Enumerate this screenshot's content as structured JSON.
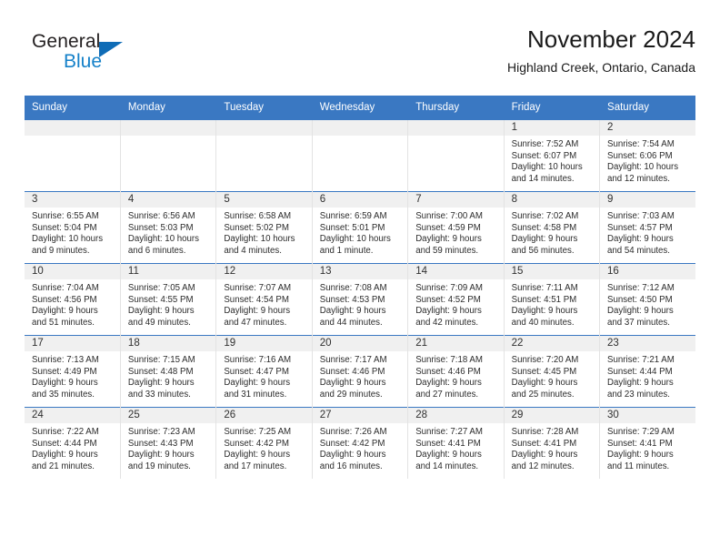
{
  "logo": {
    "word_top": "General",
    "word_bottom": "Blue",
    "triangle_color": "#0f6cb6",
    "blue_color": "#1581c9",
    "icon": "general-blue-logo"
  },
  "header": {
    "title": "November 2024",
    "subtitle": "Highland Creek, Ontario, Canada"
  },
  "theme": {
    "accent": "#3a78c2",
    "date_strip": "#f0f0f0",
    "grid_line": "#e3e3e3"
  },
  "weekdays": [
    "Sunday",
    "Monday",
    "Tuesday",
    "Wednesday",
    "Thursday",
    "Friday",
    "Saturday"
  ],
  "labels": {
    "sunrise": "Sunrise:",
    "sunset": "Sunset:",
    "daylight": "Daylight:"
  },
  "weeks": [
    [
      {
        "date": "",
        "empty": true
      },
      {
        "date": "",
        "empty": true
      },
      {
        "date": "",
        "empty": true
      },
      {
        "date": "",
        "empty": true
      },
      {
        "date": "",
        "empty": true
      },
      {
        "date": "1",
        "sunrise": "Sunrise: 7:52 AM",
        "sunset": "Sunset: 6:07 PM",
        "daylight_1": "Daylight: 10 hours",
        "daylight_2": "and 14 minutes."
      },
      {
        "date": "2",
        "sunrise": "Sunrise: 7:54 AM",
        "sunset": "Sunset: 6:06 PM",
        "daylight_1": "Daylight: 10 hours",
        "daylight_2": "and 12 minutes."
      }
    ],
    [
      {
        "date": "3",
        "sunrise": "Sunrise: 6:55 AM",
        "sunset": "Sunset: 5:04 PM",
        "daylight_1": "Daylight: 10 hours",
        "daylight_2": "and 9 minutes."
      },
      {
        "date": "4",
        "sunrise": "Sunrise: 6:56 AM",
        "sunset": "Sunset: 5:03 PM",
        "daylight_1": "Daylight: 10 hours",
        "daylight_2": "and 6 minutes."
      },
      {
        "date": "5",
        "sunrise": "Sunrise: 6:58 AM",
        "sunset": "Sunset: 5:02 PM",
        "daylight_1": "Daylight: 10 hours",
        "daylight_2": "and 4 minutes."
      },
      {
        "date": "6",
        "sunrise": "Sunrise: 6:59 AM",
        "sunset": "Sunset: 5:01 PM",
        "daylight_1": "Daylight: 10 hours",
        "daylight_2": "and 1 minute."
      },
      {
        "date": "7",
        "sunrise": "Sunrise: 7:00 AM",
        "sunset": "Sunset: 4:59 PM",
        "daylight_1": "Daylight: 9 hours",
        "daylight_2": "and 59 minutes."
      },
      {
        "date": "8",
        "sunrise": "Sunrise: 7:02 AM",
        "sunset": "Sunset: 4:58 PM",
        "daylight_1": "Daylight: 9 hours",
        "daylight_2": "and 56 minutes."
      },
      {
        "date": "9",
        "sunrise": "Sunrise: 7:03 AM",
        "sunset": "Sunset: 4:57 PM",
        "daylight_1": "Daylight: 9 hours",
        "daylight_2": "and 54 minutes."
      }
    ],
    [
      {
        "date": "10",
        "sunrise": "Sunrise: 7:04 AM",
        "sunset": "Sunset: 4:56 PM",
        "daylight_1": "Daylight: 9 hours",
        "daylight_2": "and 51 minutes."
      },
      {
        "date": "11",
        "sunrise": "Sunrise: 7:05 AM",
        "sunset": "Sunset: 4:55 PM",
        "daylight_1": "Daylight: 9 hours",
        "daylight_2": "and 49 minutes."
      },
      {
        "date": "12",
        "sunrise": "Sunrise: 7:07 AM",
        "sunset": "Sunset: 4:54 PM",
        "daylight_1": "Daylight: 9 hours",
        "daylight_2": "and 47 minutes."
      },
      {
        "date": "13",
        "sunrise": "Sunrise: 7:08 AM",
        "sunset": "Sunset: 4:53 PM",
        "daylight_1": "Daylight: 9 hours",
        "daylight_2": "and 44 minutes."
      },
      {
        "date": "14",
        "sunrise": "Sunrise: 7:09 AM",
        "sunset": "Sunset: 4:52 PM",
        "daylight_1": "Daylight: 9 hours",
        "daylight_2": "and 42 minutes."
      },
      {
        "date": "15",
        "sunrise": "Sunrise: 7:11 AM",
        "sunset": "Sunset: 4:51 PM",
        "daylight_1": "Daylight: 9 hours",
        "daylight_2": "and 40 minutes."
      },
      {
        "date": "16",
        "sunrise": "Sunrise: 7:12 AM",
        "sunset": "Sunset: 4:50 PM",
        "daylight_1": "Daylight: 9 hours",
        "daylight_2": "and 37 minutes."
      }
    ],
    [
      {
        "date": "17",
        "sunrise": "Sunrise: 7:13 AM",
        "sunset": "Sunset: 4:49 PM",
        "daylight_1": "Daylight: 9 hours",
        "daylight_2": "and 35 minutes."
      },
      {
        "date": "18",
        "sunrise": "Sunrise: 7:15 AM",
        "sunset": "Sunset: 4:48 PM",
        "daylight_1": "Daylight: 9 hours",
        "daylight_2": "and 33 minutes."
      },
      {
        "date": "19",
        "sunrise": "Sunrise: 7:16 AM",
        "sunset": "Sunset: 4:47 PM",
        "daylight_1": "Daylight: 9 hours",
        "daylight_2": "and 31 minutes."
      },
      {
        "date": "20",
        "sunrise": "Sunrise: 7:17 AM",
        "sunset": "Sunset: 4:46 PM",
        "daylight_1": "Daylight: 9 hours",
        "daylight_2": "and 29 minutes."
      },
      {
        "date": "21",
        "sunrise": "Sunrise: 7:18 AM",
        "sunset": "Sunset: 4:46 PM",
        "daylight_1": "Daylight: 9 hours",
        "daylight_2": "and 27 minutes."
      },
      {
        "date": "22",
        "sunrise": "Sunrise: 7:20 AM",
        "sunset": "Sunset: 4:45 PM",
        "daylight_1": "Daylight: 9 hours",
        "daylight_2": "and 25 minutes."
      },
      {
        "date": "23",
        "sunrise": "Sunrise: 7:21 AM",
        "sunset": "Sunset: 4:44 PM",
        "daylight_1": "Daylight: 9 hours",
        "daylight_2": "and 23 minutes."
      }
    ],
    [
      {
        "date": "24",
        "sunrise": "Sunrise: 7:22 AM",
        "sunset": "Sunset: 4:44 PM",
        "daylight_1": "Daylight: 9 hours",
        "daylight_2": "and 21 minutes."
      },
      {
        "date": "25",
        "sunrise": "Sunrise: 7:23 AM",
        "sunset": "Sunset: 4:43 PM",
        "daylight_1": "Daylight: 9 hours",
        "daylight_2": "and 19 minutes."
      },
      {
        "date": "26",
        "sunrise": "Sunrise: 7:25 AM",
        "sunset": "Sunset: 4:42 PM",
        "daylight_1": "Daylight: 9 hours",
        "daylight_2": "and 17 minutes."
      },
      {
        "date": "27",
        "sunrise": "Sunrise: 7:26 AM",
        "sunset": "Sunset: 4:42 PM",
        "daylight_1": "Daylight: 9 hours",
        "daylight_2": "and 16 minutes."
      },
      {
        "date": "28",
        "sunrise": "Sunrise: 7:27 AM",
        "sunset": "Sunset: 4:41 PM",
        "daylight_1": "Daylight: 9 hours",
        "daylight_2": "and 14 minutes."
      },
      {
        "date": "29",
        "sunrise": "Sunrise: 7:28 AM",
        "sunset": "Sunset: 4:41 PM",
        "daylight_1": "Daylight: 9 hours",
        "daylight_2": "and 12 minutes."
      },
      {
        "date": "30",
        "sunrise": "Sunrise: 7:29 AM",
        "sunset": "Sunset: 4:41 PM",
        "daylight_1": "Daylight: 9 hours",
        "daylight_2": "and 11 minutes."
      }
    ]
  ]
}
